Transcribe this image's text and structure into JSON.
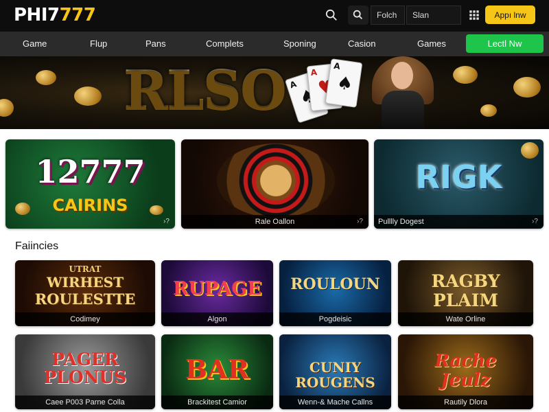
{
  "header": {
    "logo_main": "PHI7",
    "logo_accent": "777",
    "field_1_value": "Folch",
    "field_2_value": "Slan",
    "apply_label": "Appı lnw"
  },
  "nav": {
    "items": [
      "Game",
      "Flup",
      "Pans",
      "Complets",
      "Sponing",
      "Casion",
      "Games"
    ],
    "cta_label": "Lectl Nw"
  },
  "hero": {
    "title": "RLSO",
    "card_suits": [
      "♠",
      "A",
      "♥",
      "A"
    ]
  },
  "featured": [
    {
      "art_text_1": "12777",
      "art_text_2": "CAIRINS",
      "caption": "",
      "arrow": "›?"
    },
    {
      "art_text_1": "",
      "art_text_2": "",
      "caption": "Rale Oallon",
      "arrow": "›?"
    },
    {
      "art_text_1": "RIGK",
      "art_text_2": "",
      "caption": "Pulllly Dogest",
      "arrow": "›?"
    }
  ],
  "section_title": "Faiincies",
  "games": [
    {
      "art_text_1": "UTRAT",
      "art_text_2": "WIRHEST",
      "art_text_3": "ROULESTTE",
      "caption": "Codimey"
    },
    {
      "art_text_1": "RUPAGE",
      "art_text_2": "",
      "art_text_3": "",
      "caption": "Algon"
    },
    {
      "art_text_1": "ROULOUN",
      "art_text_2": "",
      "art_text_3": "",
      "caption": "Pogdeisic"
    },
    {
      "art_text_1": "RAGBY",
      "art_text_2": "PLAIM",
      "art_text_3": "",
      "caption": "Wate Orline"
    },
    {
      "art_text_1": "PAGER",
      "art_text_2": "PLONUS",
      "art_text_3": "",
      "caption": "Caee P003 Parne Colla"
    },
    {
      "art_text_1": "BAR",
      "art_text_2": "",
      "art_text_3": "",
      "caption": "Brackitest Camior"
    },
    {
      "art_text_1": "CUNIY",
      "art_text_2": "ROUGENS",
      "art_text_3": "",
      "caption": "Wenn-& Mache Callns"
    },
    {
      "art_text_1": "Rache",
      "art_text_2": "Jeulz",
      "art_text_3": "",
      "caption": "Rautily Dlora"
    }
  ],
  "colors": {
    "brand_yellow": "#f5c518",
    "cta_green": "#1fc44a",
    "header_bg": "#0d0d0d",
    "nav_bg": "#2b2b2b"
  },
  "icons": [
    "search-icon",
    "search-icon",
    "grid-icon"
  ]
}
